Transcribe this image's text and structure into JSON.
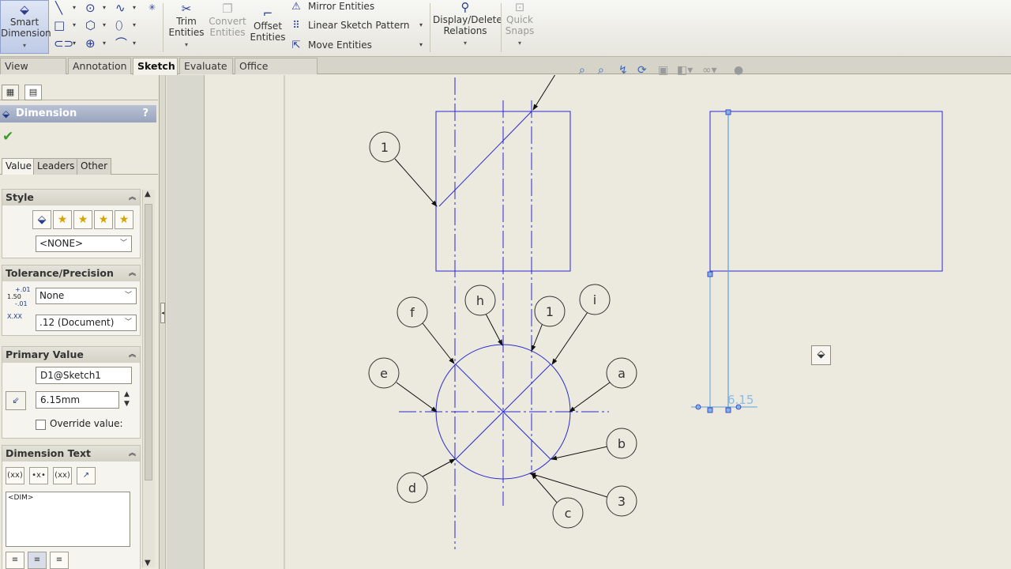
{
  "toolbar": {
    "smart_dimension_label": "Smart\nDimension",
    "smart_dimension_l1": "Smart",
    "smart_dimension_l2": "Dimension",
    "trim_l1": "Trim",
    "trim_l2": "Entities",
    "convert_l1": "Convert",
    "convert_l2": "Entities",
    "offset_l1": "Offset",
    "offset_l2": "Entities",
    "mirror_entities": "Mirror Entities",
    "linear_sketch_pattern": "Linear Sketch Pattern",
    "move_entities": "Move Entities",
    "display_delete_l1": "Display/Delete",
    "display_delete_l2": "Relations",
    "quick_snaps_l1": "Quick",
    "quick_snaps_l2": "Snaps"
  },
  "tabs": [
    "View Layout",
    "Annotation",
    "Sketch",
    "Evaluate",
    "Office Products"
  ],
  "active_tab": "Sketch",
  "panel": {
    "title": "Dimension",
    "help": "?",
    "subtabs": [
      "Value",
      "Leaders",
      "Other"
    ],
    "style": {
      "header": "Style",
      "dropdown_value": "<NONE>"
    },
    "tolerance": {
      "header": "Tolerance/Precision",
      "tolerance_label": "1.50",
      "tolerance_sup": "+.01",
      "tolerance_sub": "-.01",
      "tolerance_value": "None",
      "precision_label": "X.XX",
      "precision_value": ".12 (Document)"
    },
    "primary_value": {
      "header": "Primary Value",
      "name": "D1@Sketch1",
      "value": "6.15mm",
      "override_label": "Override value:"
    },
    "dimension_text": {
      "header": "Dimension Text",
      "btn1": "(xx)",
      "btn2": "•x•",
      "btn3": "(xx)",
      "content": "<DIM>"
    }
  },
  "canvas": {
    "balloons": [
      "1",
      "f",
      "h",
      "1",
      "i",
      "e",
      "a",
      "b",
      "d",
      "c",
      "3"
    ],
    "dimension_value": "6.15"
  },
  "colors": {
    "sketch_blue": "#2b2bd0",
    "selected_light": "#5f9fd6",
    "canvas_bg": "#eceadf",
    "panel_title": "#99a4bd"
  }
}
